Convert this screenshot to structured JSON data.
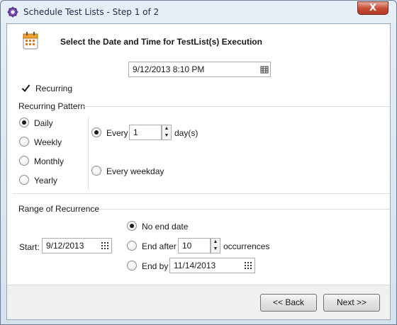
{
  "window": {
    "title": "Schedule Test Lists - Step 1 of 2",
    "close_label": "X"
  },
  "header": {
    "heading": "Select the Date and Time for TestList(s) Execution"
  },
  "datetime": {
    "value": "9/12/2013 8:10 PM"
  },
  "recurring": {
    "label": "Recurring",
    "checked": true
  },
  "pattern": {
    "group_label": "Recurring Pattern",
    "options": [
      "Daily",
      "Weekly",
      "Monthly",
      "Yearly"
    ],
    "selected": "Daily",
    "every_label": "Every",
    "every_value": "1",
    "days_label": "day(s)",
    "every_weekday_label": "Every weekday"
  },
  "range": {
    "group_label": "Range of Recurrence",
    "start_label": "Start:",
    "start_value": "9/12/2013",
    "no_end_label": "No end date",
    "end_after_label": "End after",
    "end_after_value": "10",
    "occurrences_label": "occurrences",
    "end_by_label": "End by",
    "end_by_value": "11/14/2013"
  },
  "footer": {
    "back_label": "<< Back",
    "next_label": "Next >>"
  }
}
